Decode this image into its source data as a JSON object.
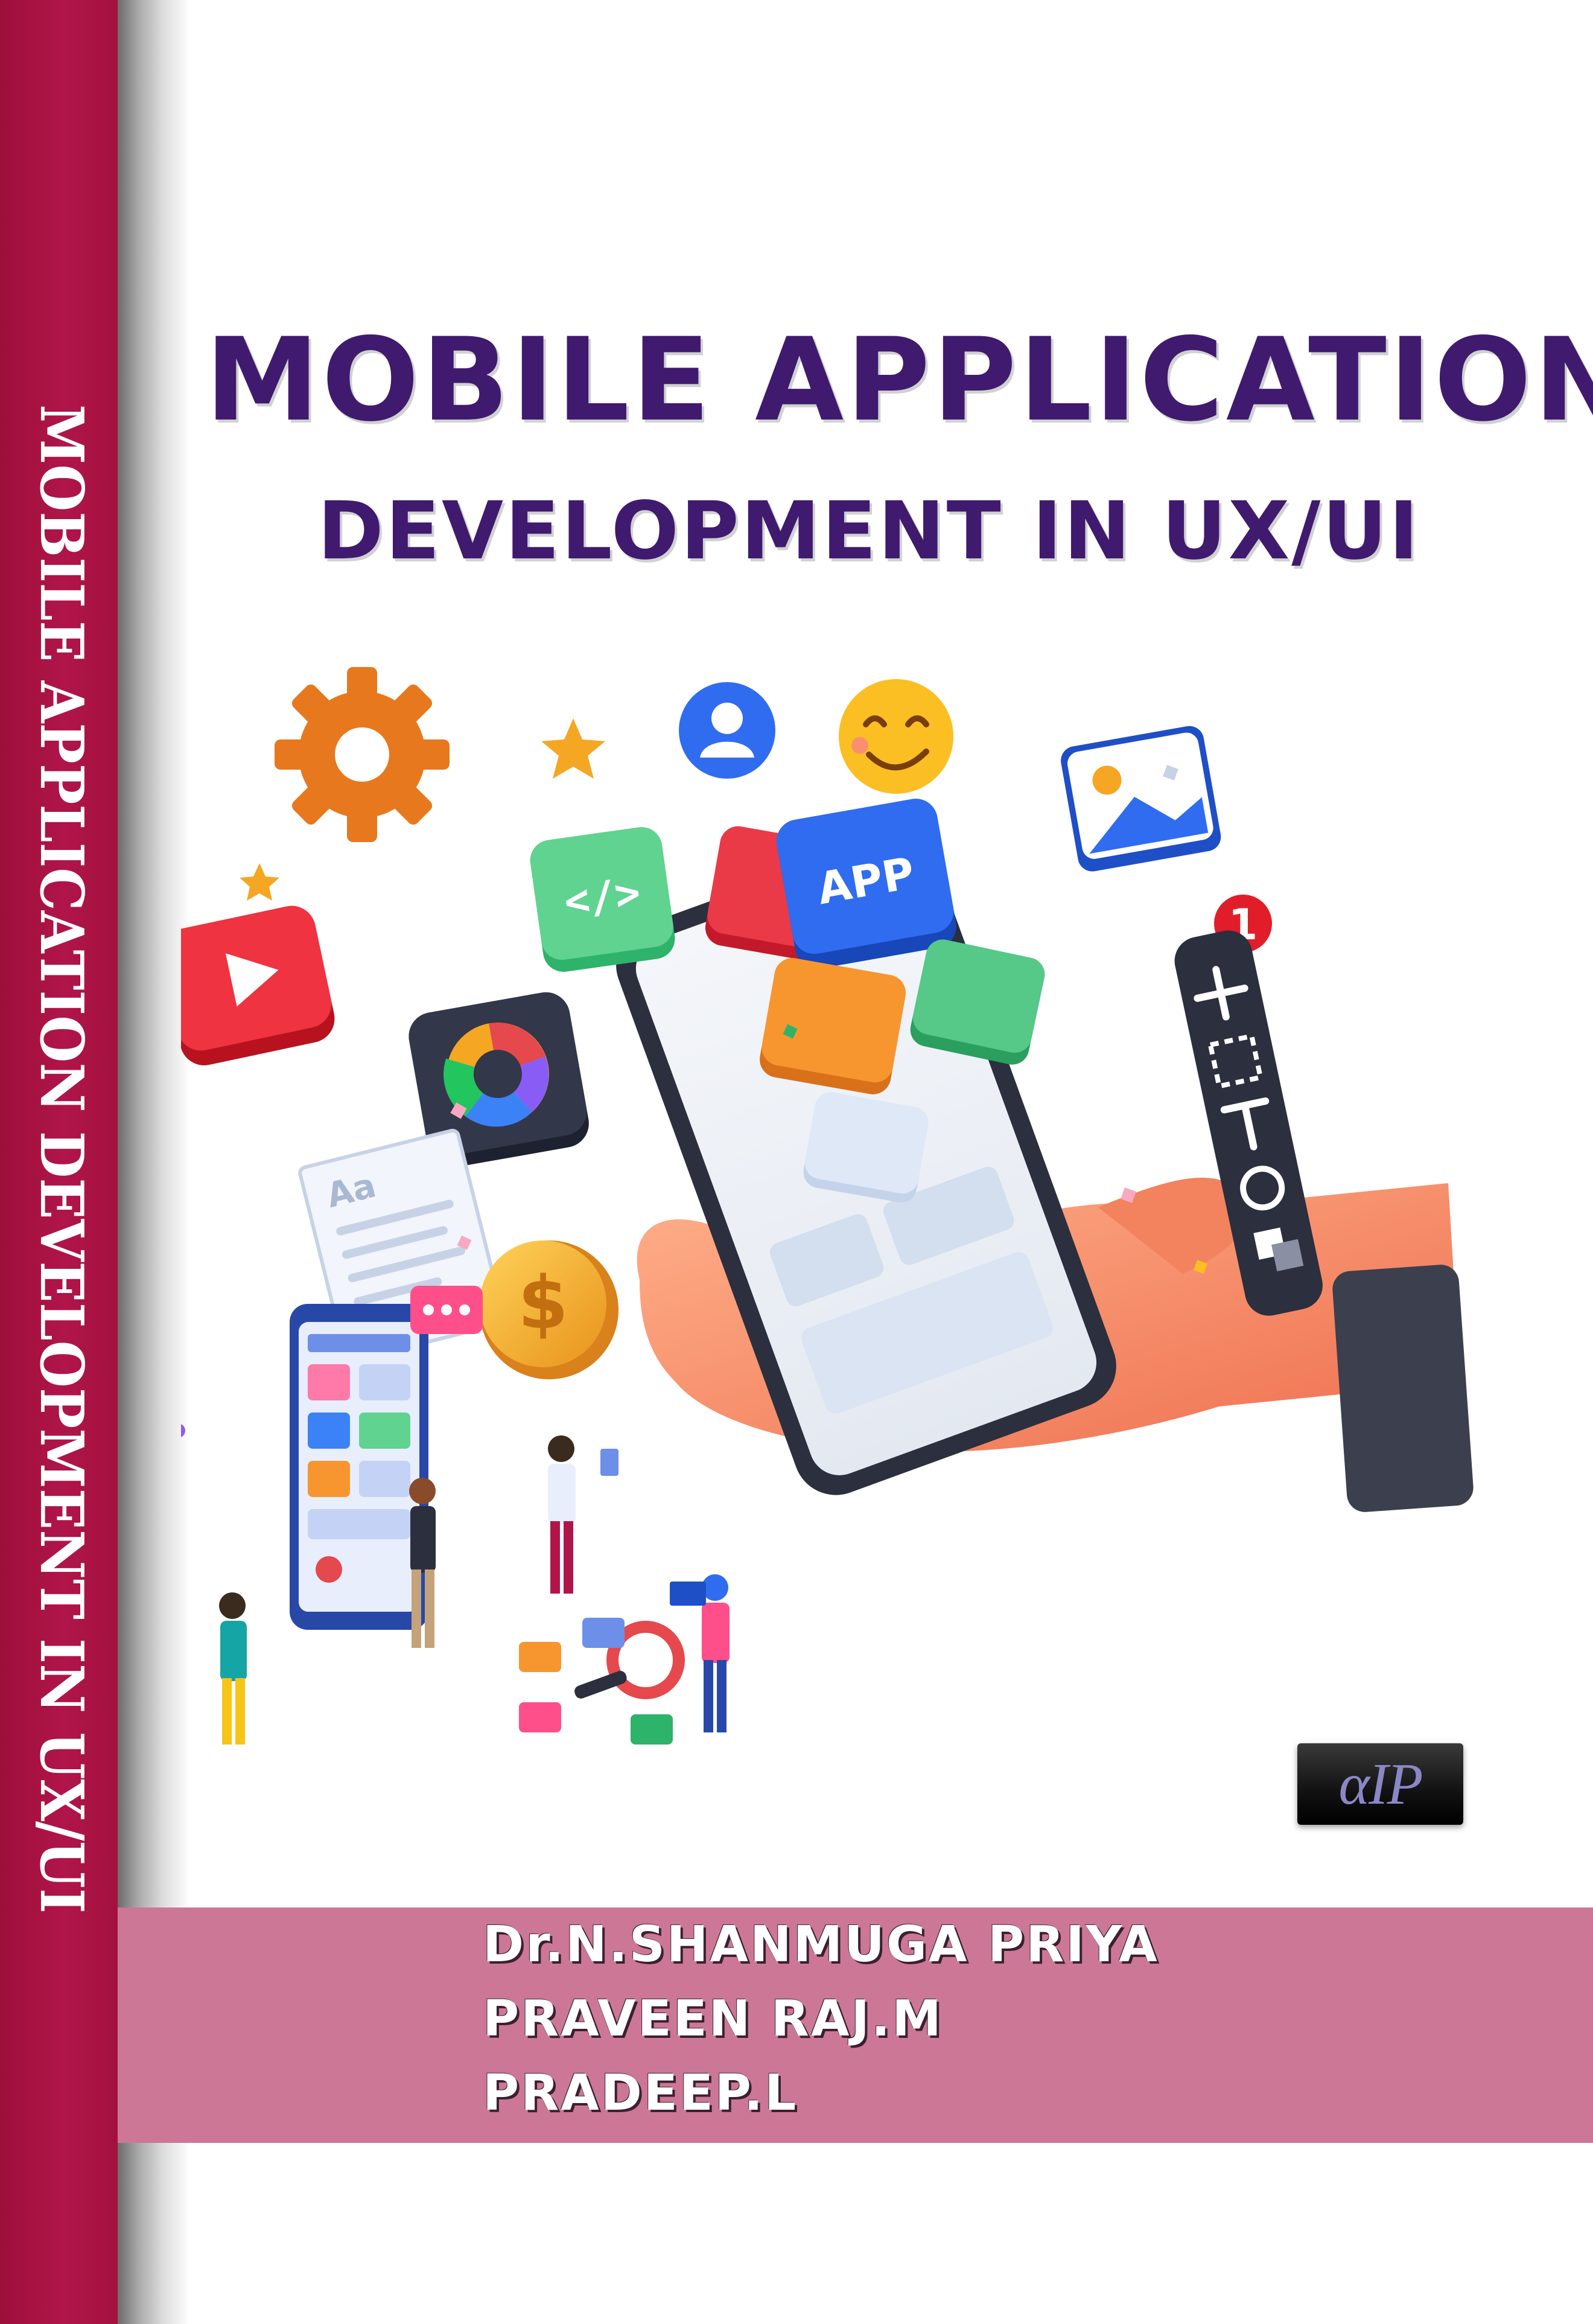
{
  "cover": {
    "spine_title": "MOBILE APPLICATION DEVELOPMENT IN UX/UI",
    "title_line_1": "MOBILE APPLICATION",
    "title_line_2": "DEVELOPMENT IN UX/UI",
    "authors": [
      "Dr.N.SHANMUGA PRIYA",
      "PRAVEEN RAJ.M",
      "PRADEEP.L"
    ],
    "publisher_logo_text": "αIP",
    "illustration_labels": {
      "code_tile": "</>",
      "app_tile": "APP",
      "notification_count": "1",
      "text_sample": "Aa",
      "currency_symbol": "$"
    }
  },
  "colors": {
    "spine": "#b0154a",
    "title": "#3f1a6e",
    "author_band": "#cc7795",
    "author_text": "#ffffff",
    "skin": "#f08a66",
    "phone": "#2b2f3e"
  }
}
